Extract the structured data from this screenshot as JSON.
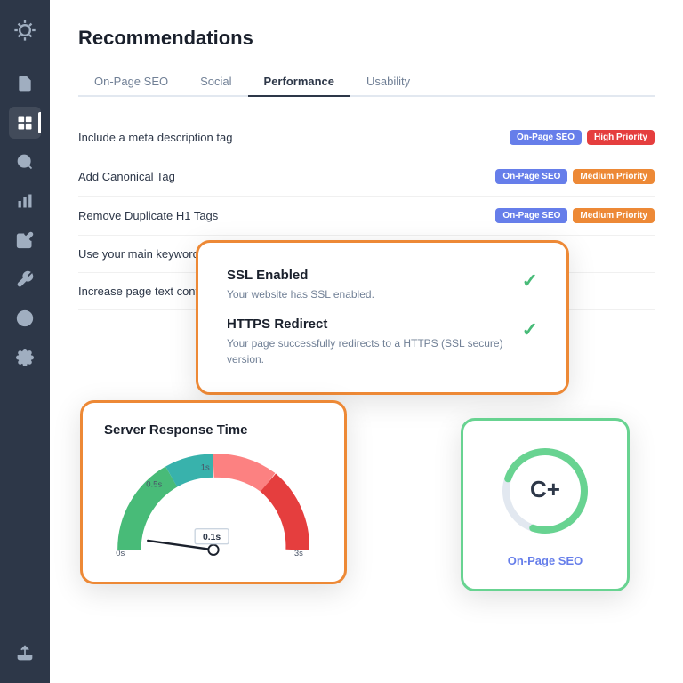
{
  "sidebar": {
    "logo_label": "Logo",
    "icons": [
      {
        "name": "copy-icon",
        "symbol": "⟳",
        "active": false
      },
      {
        "name": "edit-icon",
        "symbol": "✎",
        "active": false
      },
      {
        "name": "copy2-icon",
        "symbol": "❑",
        "active": true
      },
      {
        "name": "search-icon",
        "symbol": "⌕",
        "active": false
      },
      {
        "name": "chart-icon",
        "symbol": "▦",
        "active": false
      },
      {
        "name": "pen-icon",
        "symbol": "✒",
        "active": false
      },
      {
        "name": "tool-icon",
        "symbol": "⚒",
        "active": false
      },
      {
        "name": "globe-icon",
        "symbol": "◎",
        "active": false
      },
      {
        "name": "settings-icon",
        "symbol": "⚙",
        "active": false
      },
      {
        "name": "export-icon",
        "symbol": "↑",
        "active": false
      }
    ]
  },
  "page": {
    "title": "Recommendations"
  },
  "tabs": [
    {
      "label": "On-Page SEO",
      "active": false
    },
    {
      "label": "Social",
      "active": false
    },
    {
      "label": "Performance",
      "active": true
    },
    {
      "label": "Usability",
      "active": false
    }
  ],
  "recommendations": [
    {
      "text": "Include a meta description tag",
      "badges": [
        {
          "label": "On-Page SEO",
          "type": "seo"
        },
        {
          "label": "High Priority",
          "type": "high"
        }
      ]
    },
    {
      "text": "Add Canonical Tag",
      "badges": [
        {
          "label": "On-Page SEO",
          "type": "seo"
        },
        {
          "label": "Medium Priority",
          "type": "medium"
        }
      ]
    },
    {
      "text": "Remove Duplicate H1 Tags",
      "badges": [
        {
          "label": "On-Page SEO",
          "type": "seo"
        },
        {
          "label": "Medium Priority",
          "type": "medium"
        }
      ]
    },
    {
      "text": "Use your main keyword in your title and meta tags",
      "badges": []
    },
    {
      "text": "Increase page text content",
      "badges": []
    }
  ],
  "ssl_card": {
    "items": [
      {
        "title": "SSL Enabled",
        "description": "Your website has SSL enabled."
      },
      {
        "title": "HTTPS Redirect",
        "description": "Your page successfully redirects to a HTTPS (SSL secure) version."
      }
    ]
  },
  "server_card": {
    "title": "Server Response Time",
    "value": "0.1s",
    "labels": [
      "0s",
      "0.5s",
      "1s",
      "3s"
    ],
    "colors": {
      "green": "#48bb78",
      "teal": "#38b2ac",
      "red": "#fc8181"
    }
  },
  "score_card": {
    "grade": "C+",
    "label": "On-Page SEO",
    "colors": {
      "arc_green": "#68d391",
      "arc_gray": "#e2e8f0"
    }
  },
  "colors": {
    "sidebar_bg": "#2d3748",
    "brand_orange": "#ed8936",
    "brand_green": "#68d391",
    "badge_seo": "#667eea",
    "badge_high": "#e53e3e",
    "badge_medium": "#ed8936"
  }
}
